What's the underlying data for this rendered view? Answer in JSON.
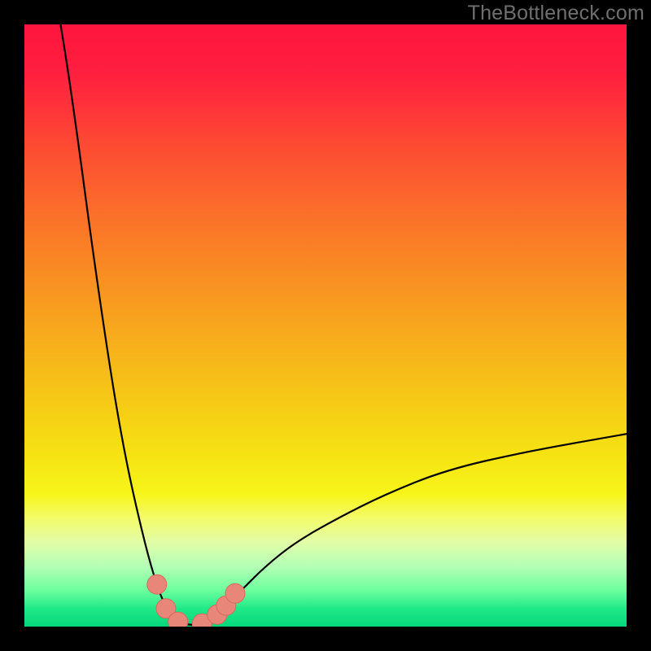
{
  "watermark": "TheBottleneck.com",
  "gradient_stops": [
    {
      "offset": 0.0,
      "color": "#ff153e"
    },
    {
      "offset": 0.08,
      "color": "#ff1f3f"
    },
    {
      "offset": 0.2,
      "color": "#fd4a33"
    },
    {
      "offset": 0.35,
      "color": "#fa7a27"
    },
    {
      "offset": 0.5,
      "color": "#f7a61d"
    },
    {
      "offset": 0.62,
      "color": "#f6c816"
    },
    {
      "offset": 0.72,
      "color": "#f6e413"
    },
    {
      "offset": 0.78,
      "color": "#f7f51a"
    },
    {
      "offset": 0.82,
      "color": "#f4fb6a"
    },
    {
      "offset": 0.86,
      "color": "#e2fda8"
    },
    {
      "offset": 0.9,
      "color": "#b3ffb5"
    },
    {
      "offset": 0.94,
      "color": "#6cff9e"
    },
    {
      "offset": 0.97,
      "color": "#20e987"
    },
    {
      "offset": 1.0,
      "color": "#05d77c"
    }
  ],
  "curve_color": "#000000",
  "curve_width": 2.2,
  "marker_color": "#e88779",
  "marker_stroke": "#d46b5d",
  "marker_radius": 12,
  "chart_data": {
    "type": "line",
    "title": "",
    "xlabel": "",
    "ylabel": "",
    "xlim": [
      0,
      100
    ],
    "ylim": [
      0,
      100
    ],
    "note": "V-shaped bottleneck curve. X is parameter sweep (0–100). Y is bottleneck %, 0 at bottom. Curve has its minimum near x≈27 where y≈0; both arms rise steeply, left arm reaching y=100 near x=6, right arm reaching y≈32 at x=100. Markers cluster around the valley.",
    "series": [
      {
        "name": "bottleneck-curve",
        "points": [
          {
            "x": 6,
            "y": 100
          },
          {
            "x": 7,
            "y": 94
          },
          {
            "x": 9,
            "y": 80
          },
          {
            "x": 11,
            "y": 65
          },
          {
            "x": 13,
            "y": 51
          },
          {
            "x": 15,
            "y": 38
          },
          {
            "x": 17,
            "y": 27
          },
          {
            "x": 19,
            "y": 18
          },
          {
            "x": 21,
            "y": 10
          },
          {
            "x": 23,
            "y": 4
          },
          {
            "x": 25,
            "y": 1
          },
          {
            "x": 27,
            "y": 0.3
          },
          {
            "x": 29,
            "y": 0.3
          },
          {
            "x": 31,
            "y": 1
          },
          {
            "x": 33,
            "y": 3
          },
          {
            "x": 36,
            "y": 6
          },
          {
            "x": 40,
            "y": 10
          },
          {
            "x": 45,
            "y": 14
          },
          {
            "x": 52,
            "y": 18
          },
          {
            "x": 60,
            "y": 22
          },
          {
            "x": 70,
            "y": 26
          },
          {
            "x": 83,
            "y": 29
          },
          {
            "x": 100,
            "y": 32
          }
        ]
      }
    ],
    "markers": [
      {
        "x": 22.0,
        "y": 7.0
      },
      {
        "x": 23.5,
        "y": 3.0
      },
      {
        "x": 25.5,
        "y": 0.8
      },
      {
        "x": 29.5,
        "y": 0.5
      },
      {
        "x": 32.0,
        "y": 2.0
      },
      {
        "x": 33.5,
        "y": 3.5
      },
      {
        "x": 35.0,
        "y": 5.5
      }
    ]
  }
}
